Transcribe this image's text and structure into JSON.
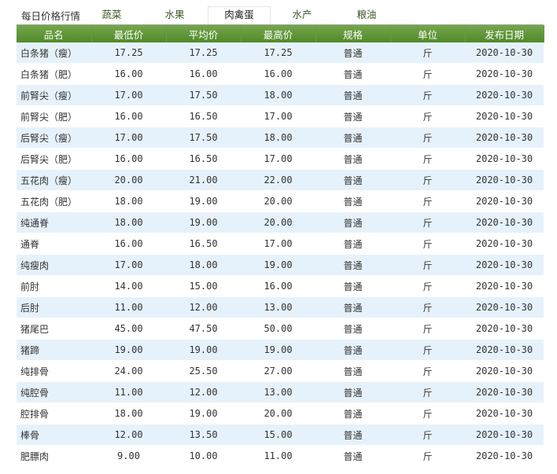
{
  "title": "每日价格行情",
  "tabs": [
    "蔬菜",
    "水果",
    "肉禽蛋",
    "水产",
    "粮油"
  ],
  "active_tab": "肉禽蛋",
  "columns": [
    "品名",
    "最低价",
    "平均价",
    "最高价",
    "规格",
    "单位",
    "发布日期"
  ],
  "rows": [
    {
      "name": "白条猪（瘦）",
      "min": "17.25",
      "avg": "17.25",
      "max": "17.25",
      "spec": "普通",
      "unit": "斤",
      "date": "2020-10-30"
    },
    {
      "name": "白条猪（肥）",
      "min": "16.00",
      "avg": "16.00",
      "max": "16.00",
      "spec": "普通",
      "unit": "斤",
      "date": "2020-10-30"
    },
    {
      "name": "前腎尖（瘦）",
      "min": "17.00",
      "avg": "17.50",
      "max": "18.00",
      "spec": "普通",
      "unit": "斤",
      "date": "2020-10-30"
    },
    {
      "name": "前腎尖（肥）",
      "min": "16.00",
      "avg": "16.50",
      "max": "17.00",
      "spec": "普通",
      "unit": "斤",
      "date": "2020-10-30"
    },
    {
      "name": "后腎尖（瘦）",
      "min": "17.00",
      "avg": "17.50",
      "max": "18.00",
      "spec": "普通",
      "unit": "斤",
      "date": "2020-10-30"
    },
    {
      "name": "后腎尖（肥）",
      "min": "16.00",
      "avg": "16.50",
      "max": "17.00",
      "spec": "普通",
      "unit": "斤",
      "date": "2020-10-30"
    },
    {
      "name": "五花肉（瘦）",
      "min": "20.00",
      "avg": "21.00",
      "max": "22.00",
      "spec": "普通",
      "unit": "斤",
      "date": "2020-10-30"
    },
    {
      "name": "五花肉（肥）",
      "min": "18.00",
      "avg": "19.00",
      "max": "20.00",
      "spec": "普通",
      "unit": "斤",
      "date": "2020-10-30"
    },
    {
      "name": "纯通脊",
      "min": "18.00",
      "avg": "19.00",
      "max": "20.00",
      "spec": "普通",
      "unit": "斤",
      "date": "2020-10-30"
    },
    {
      "name": "通脊",
      "min": "16.00",
      "avg": "16.50",
      "max": "17.00",
      "spec": "普通",
      "unit": "斤",
      "date": "2020-10-30"
    },
    {
      "name": "纯瘦肉",
      "min": "17.00",
      "avg": "18.00",
      "max": "19.00",
      "spec": "普通",
      "unit": "斤",
      "date": "2020-10-30"
    },
    {
      "name": "前肘",
      "min": "14.00",
      "avg": "15.00",
      "max": "16.00",
      "spec": "普通",
      "unit": "斤",
      "date": "2020-10-30"
    },
    {
      "name": "后肘",
      "min": "11.00",
      "avg": "12.00",
      "max": "13.00",
      "spec": "普通",
      "unit": "斤",
      "date": "2020-10-30"
    },
    {
      "name": "猪尾巴",
      "min": "45.00",
      "avg": "47.50",
      "max": "50.00",
      "spec": "普通",
      "unit": "斤",
      "date": "2020-10-30"
    },
    {
      "name": "猪蹄",
      "min": "19.00",
      "avg": "19.00",
      "max": "19.00",
      "spec": "普通",
      "unit": "斤",
      "date": "2020-10-30"
    },
    {
      "name": "纯排骨",
      "min": "24.00",
      "avg": "25.50",
      "max": "27.00",
      "spec": "普通",
      "unit": "斤",
      "date": "2020-10-30"
    },
    {
      "name": "纯腔骨",
      "min": "11.00",
      "avg": "12.00",
      "max": "13.00",
      "spec": "普通",
      "unit": "斤",
      "date": "2020-10-30"
    },
    {
      "name": "腔排骨",
      "min": "18.00",
      "avg": "19.00",
      "max": "20.00",
      "spec": "普通",
      "unit": "斤",
      "date": "2020-10-30"
    },
    {
      "name": "棒骨",
      "min": "12.00",
      "avg": "13.50",
      "max": "15.00",
      "spec": "普通",
      "unit": "斤",
      "date": "2020-10-30"
    },
    {
      "name": "肥膘肉",
      "min": "9.00",
      "avg": "10.00",
      "max": "11.00",
      "spec": "普通",
      "unit": "斤",
      "date": "2020-10-30"
    }
  ]
}
